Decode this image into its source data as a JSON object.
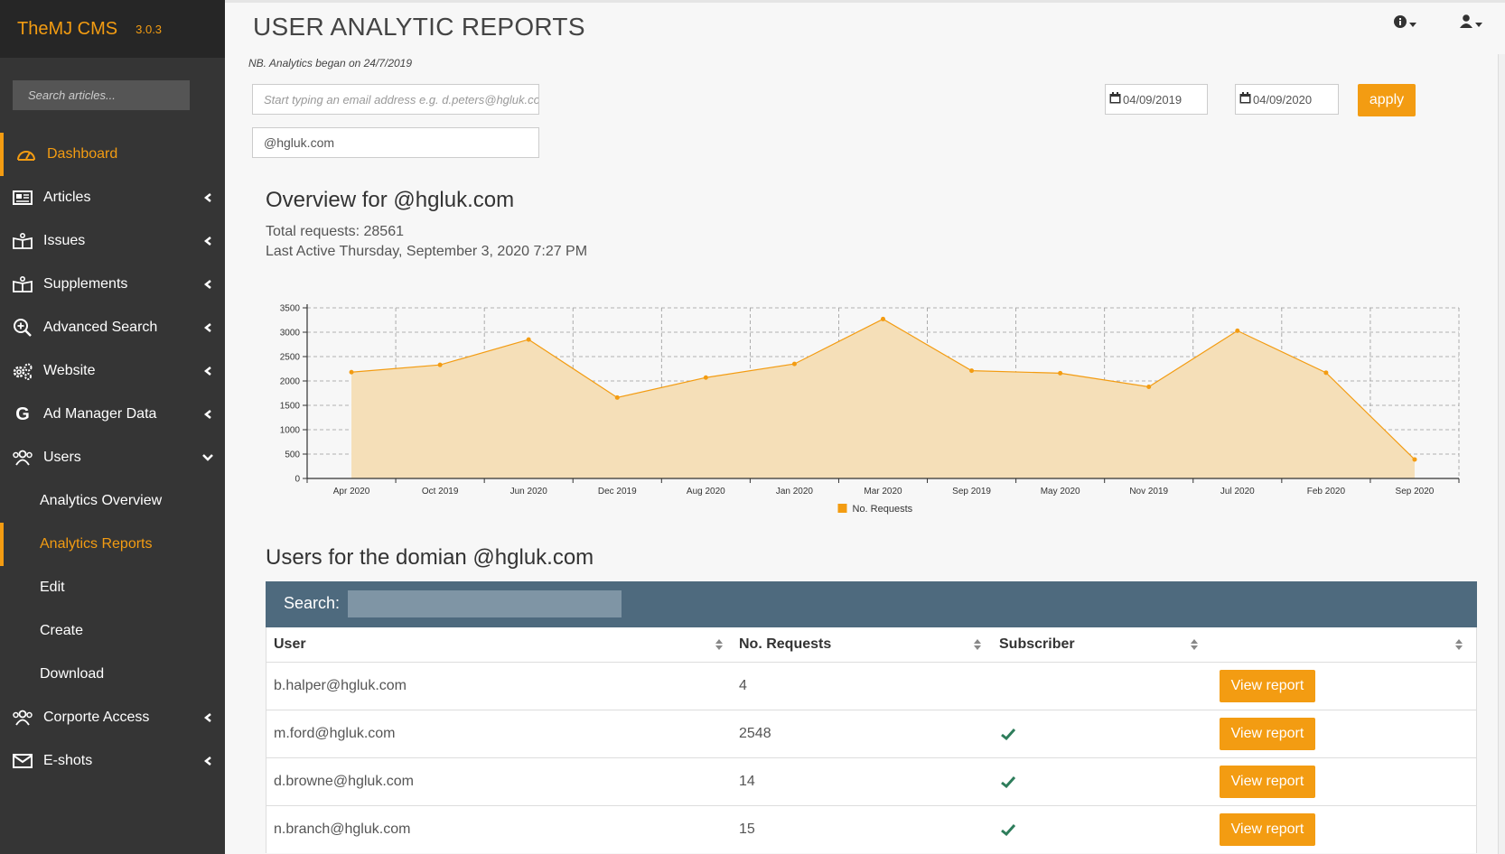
{
  "app": {
    "name": "TheMJ CMS",
    "version": "3.0.3"
  },
  "sidebar": {
    "search_placeholder": "Search articles...",
    "items": [
      {
        "label": "Dashboard",
        "icon": "dashboard-icon"
      },
      {
        "label": "Articles",
        "icon": "newspaper-icon"
      },
      {
        "label": "Issues",
        "icon": "book-open-icon"
      },
      {
        "label": "Supplements",
        "icon": "book-open-icon"
      },
      {
        "label": "Advanced Search",
        "icon": "search-plus-icon"
      },
      {
        "label": "Website",
        "icon": "cogs-icon"
      },
      {
        "label": "Ad Manager Data",
        "icon": "google-icon"
      },
      {
        "label": "Users",
        "icon": "users-icon"
      },
      {
        "label": "Corporte Access",
        "icon": "users-icon"
      },
      {
        "label": "E-shots",
        "icon": "envelope-icon"
      }
    ],
    "sub_items": [
      {
        "label": "Analytics Overview"
      },
      {
        "label": "Analytics Reports"
      },
      {
        "label": "Edit"
      },
      {
        "label": "Create"
      },
      {
        "label": "Download"
      }
    ]
  },
  "page": {
    "title": "USER ANALYTIC REPORTS",
    "note": "NB. Analytics began on 24/7/2019",
    "email_placeholder": "Start typing an email address e.g. d.peters@hgluk.com",
    "domain_value": "@hgluk.com",
    "date_from": "04/09/2019",
    "date_to": "04/09/2020",
    "apply_label": "apply"
  },
  "overview": {
    "title": "Overview for @hgluk.com",
    "total_requests": "Total requests: 28561",
    "last_active": "Last Active Thursday, September 3, 2020 7:27 PM"
  },
  "chart_data": {
    "type": "area",
    "categories": [
      "Apr 2020",
      "Oct 2019",
      "Jun 2020",
      "Dec 2019",
      "Aug 2020",
      "Jan 2020",
      "Mar 2020",
      "Sep 2019",
      "May 2020",
      "Nov 2019",
      "Jul 2020",
      "Feb 2020",
      "Sep 2020"
    ],
    "series": [
      {
        "name": "No. Requests",
        "values": [
          2180,
          2330,
          2850,
          1660,
          2070,
          2350,
          3270,
          2210,
          2160,
          1880,
          3030,
          2170,
          390
        ]
      }
    ],
    "yticks": [
      0,
      500,
      1000,
      1500,
      2000,
      2500,
      3000,
      3500
    ],
    "ylim": [
      0,
      3500
    ],
    "title": "",
    "xlabel": "",
    "ylabel": "",
    "grid": true,
    "legend": "bottom-center",
    "colors": {
      "line": "#f39c12",
      "fill": "#f5dfb8"
    }
  },
  "users": {
    "title": "Users for the domian @hgluk.com",
    "search_label": "Search:",
    "columns": [
      "User",
      "No. Requests",
      "Subscriber",
      ""
    ],
    "rows": [
      {
        "user": "b.halper@hgluk.com",
        "requests": "4",
        "subscriber": false
      },
      {
        "user": "m.ford@hgluk.com",
        "requests": "2548",
        "subscriber": true
      },
      {
        "user": "d.browne@hgluk.com",
        "requests": "14",
        "subscriber": true
      },
      {
        "user": "n.branch@hgluk.com",
        "requests": "15",
        "subscriber": true
      }
    ],
    "view_label": "View report"
  },
  "colors": {
    "accent": "#f39c12",
    "sidebar": "#353535",
    "table_header": "#4e6a7e",
    "check": "#2e7d5b"
  }
}
